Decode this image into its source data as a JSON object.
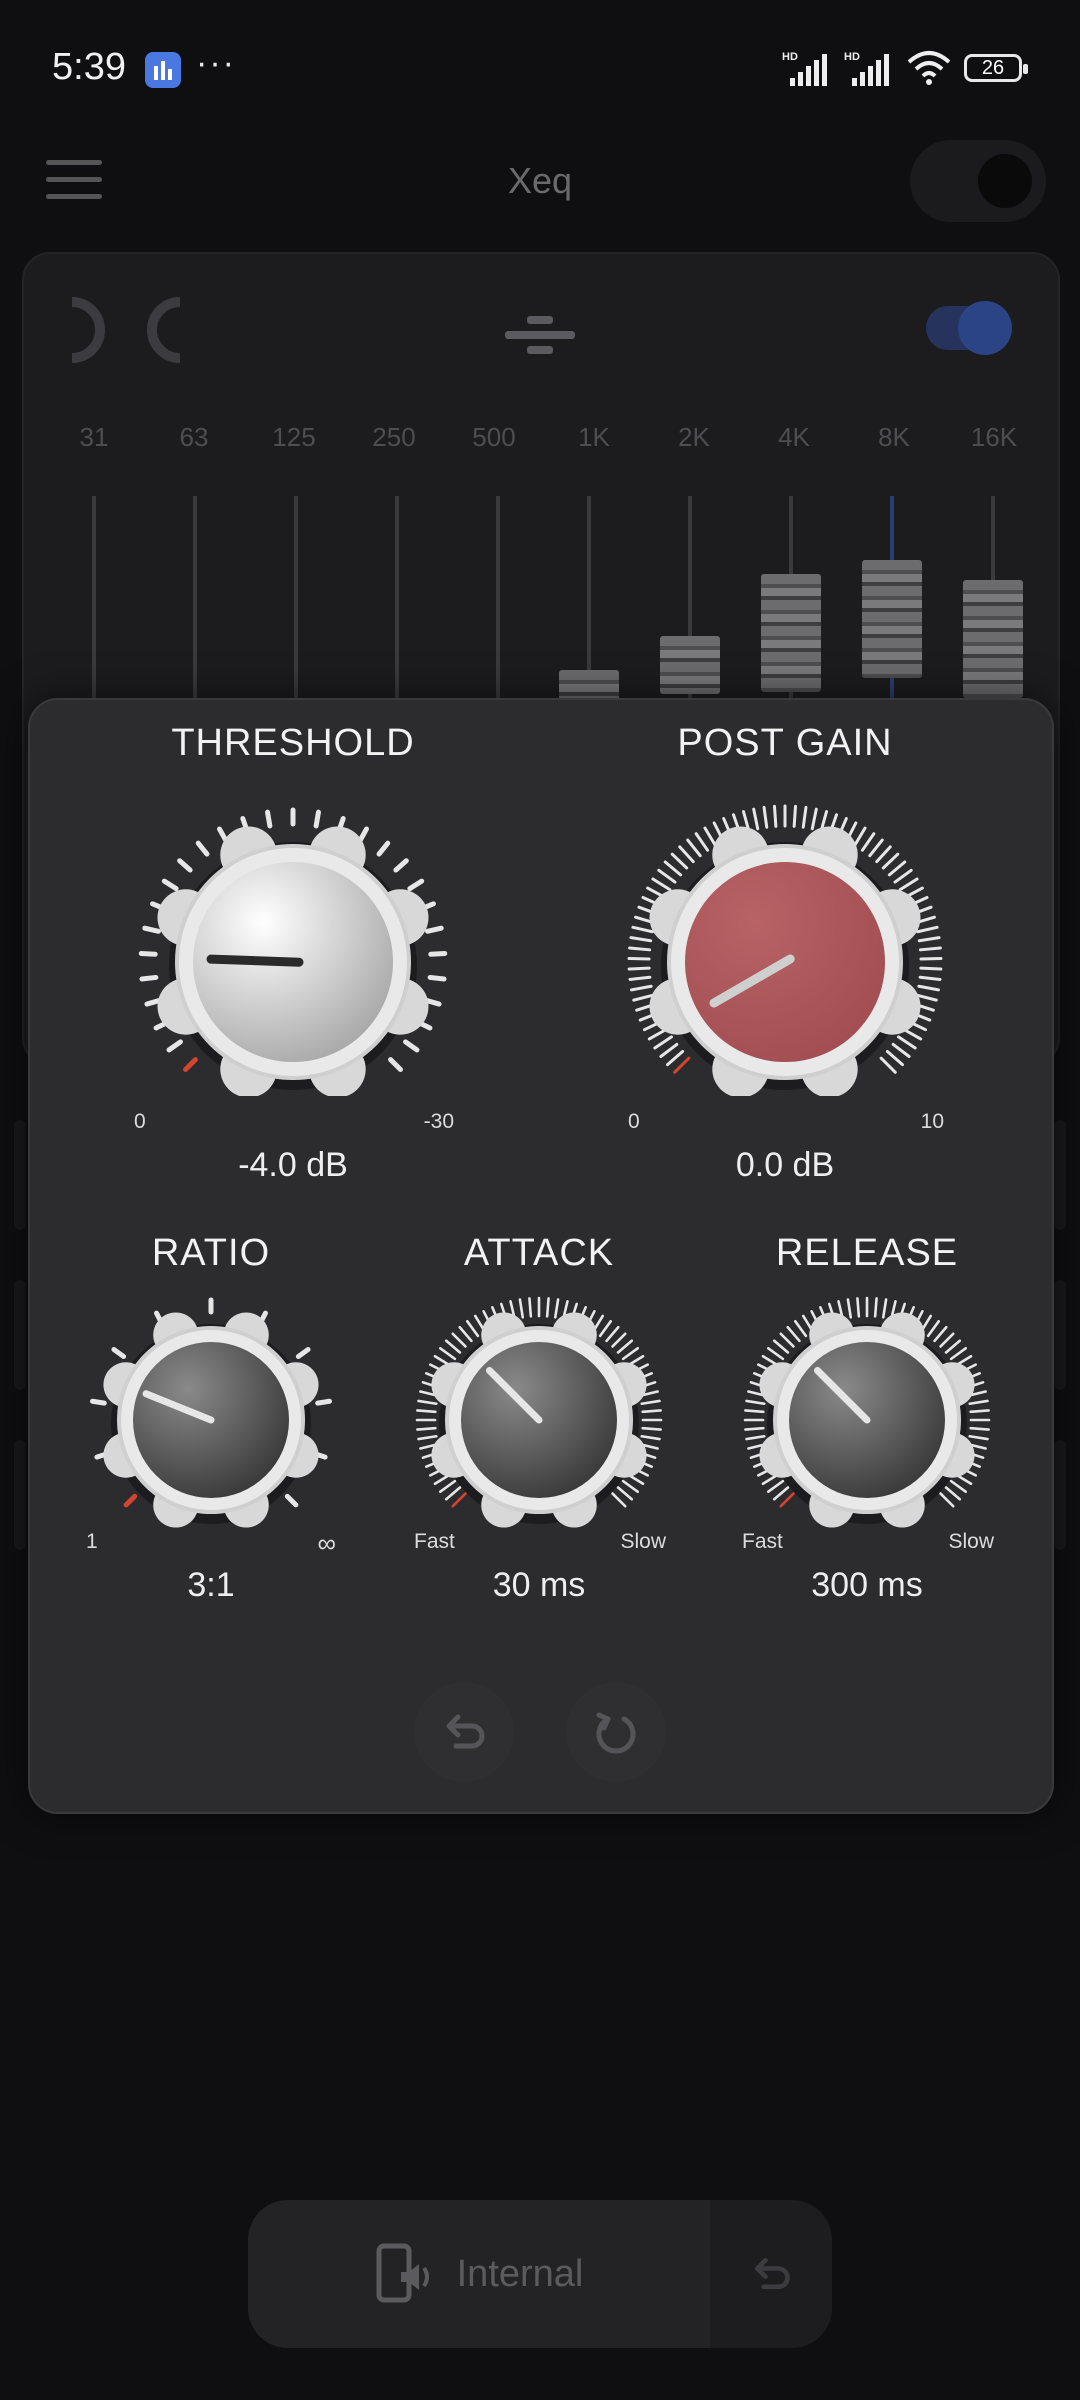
{
  "status_bar": {
    "time": "5:39",
    "overflow": "···",
    "battery": "26",
    "icons": [
      "app-notification-icon",
      "hd-signal-icon",
      "hd-signal-icon",
      "wifi-icon",
      "battery-icon"
    ]
  },
  "app_bar": {
    "title": "Xeq",
    "menu_icon": "hamburger-menu-icon",
    "power_toggle": "off"
  },
  "equalizer": {
    "logo_icon": "xc-logo-icon",
    "flat_icon": "flatten-icon",
    "enabled": true,
    "accent_color": "#2b4486",
    "bands": [
      {
        "label": "31"
      },
      {
        "label": "63"
      },
      {
        "label": "125"
      },
      {
        "label": "250"
      },
      {
        "label": "500"
      },
      {
        "label": "1K"
      },
      {
        "label": "2K"
      },
      {
        "label": "4K"
      },
      {
        "label": "8K"
      },
      {
        "label": "16K"
      }
    ]
  },
  "compressor": {
    "threshold": {
      "title": "THRESHOLD",
      "min_label": "0",
      "max_label": "-30",
      "value": "-4.0 dB"
    },
    "post_gain": {
      "title": "POST GAIN",
      "min_label": "0",
      "max_label": "10",
      "value": "0.0 dB",
      "color": "#b86366"
    },
    "ratio": {
      "title": "RATIO",
      "min_label": "1",
      "max_label": "∞",
      "value": "3:1"
    },
    "attack": {
      "title": "ATTACK",
      "min_label": "Fast",
      "max_label": "Slow",
      "value": "30 ms"
    },
    "release": {
      "title": "RELEASE",
      "min_label": "Fast",
      "max_label": "Slow",
      "value": "300 ms"
    },
    "buttons": {
      "undo_icon": "undo-icon",
      "reset_icon": "reset-icon"
    },
    "indicator_color": "#d4452f"
  },
  "bottom_bar": {
    "output_label": "Internal",
    "output_icon": "phone-speaker-icon",
    "undo_icon": "undo-icon"
  }
}
